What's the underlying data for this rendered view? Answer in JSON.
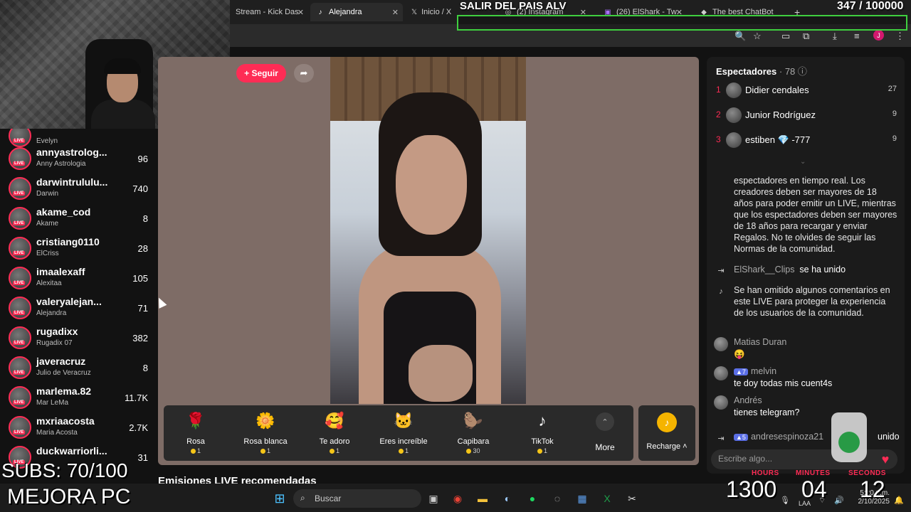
{
  "tabs": [
    {
      "label": "Stream - Kick Das",
      "icon": "kick-icon"
    },
    {
      "label": "Alejandra",
      "icon": "tiktok-icon"
    },
    {
      "label": "Inicio / X",
      "icon": "x-icon"
    },
    {
      "label": "(2) Instagram",
      "icon": "instagram-icon"
    },
    {
      "label": "(26) ElShark - Tw",
      "icon": "twitch-icon"
    },
    {
      "label": "The best ChatBot",
      "icon": "chatbot-icon"
    }
  ],
  "banner": {
    "title": "SALIR DEL PAIS ALV",
    "count": "347  / 100000"
  },
  "sidebar": {
    "items": [
      {
        "username": "",
        "display": "Evelyn",
        "count": ""
      },
      {
        "username": "annyastrolog...",
        "display": "Anny Astrologia",
        "count": "96"
      },
      {
        "username": "darwintrululu...",
        "display": "Darwin",
        "count": "740"
      },
      {
        "username": "akame_cod",
        "display": "Akame",
        "count": "8"
      },
      {
        "username": "cristiang0110",
        "display": "ElCriss",
        "count": "28"
      },
      {
        "username": "imaalexaff",
        "display": "Alexitaa",
        "count": "105"
      },
      {
        "username": "valeryalejan...",
        "display": "Alejandra",
        "count": "71"
      },
      {
        "username": "rugadixx",
        "display": "Rugadix 07",
        "count": "382"
      },
      {
        "username": "javeracruz",
        "display": "Julio de Veracruz",
        "count": "8"
      },
      {
        "username": "marlema.82",
        "display": "Mar LeMa",
        "count": "11.7K"
      },
      {
        "username": "mxriaacosta",
        "display": "Maria Acosta",
        "count": "2.7K"
      },
      {
        "username": "duckwarriorli...",
        "display": "",
        "count": "31"
      }
    ],
    "live_label": "LIVE"
  },
  "stream": {
    "follow_label": "+ Seguir",
    "share_icon": "share-icon"
  },
  "gifts": [
    {
      "name": "Rosa",
      "cost": "1",
      "icon": "rose-icon",
      "glyph": "🌹"
    },
    {
      "name": "Rosa blanca",
      "cost": "1",
      "icon": "white-rose-icon",
      "glyph": "🌼"
    },
    {
      "name": "Te adoro",
      "cost": "1",
      "icon": "heart-face-icon",
      "glyph": "🥰"
    },
    {
      "name": "Eres increíble",
      "cost": "1",
      "icon": "cat-icon",
      "glyph": "🐱"
    },
    {
      "name": "Capibara",
      "cost": "30",
      "icon": "capybara-icon",
      "glyph": "🦫"
    },
    {
      "name": "TikTok",
      "cost": "1",
      "icon": "tiktok-icon",
      "glyph": "♪"
    }
  ],
  "gift_more": "More",
  "recharge_label": "Recharge",
  "recommended_title": "Emisiones LIVE recomendadas",
  "viewers": {
    "title": "Espectadores",
    "count": "· 78",
    "list": [
      {
        "rank": "1",
        "name": "Didier cendales",
        "score": "27"
      },
      {
        "rank": "2",
        "name": "Junior Rodríguez",
        "score": "9"
      },
      {
        "rank": "3",
        "name": "estiben 💎 -777",
        "score": "9"
      }
    ]
  },
  "chat": {
    "notice": "espectadores en tiempo real. Los creadores deben ser mayores de 18 años para poder emitir un LIVE, mientras que los espectadores deben ser mayores de 18 años para recargar y enviar Regalos. No te olvides de seguir las Normas de la comunidad.",
    "joined1_name": "ElShark__Clips",
    "joined1_text": "se ha unido",
    "omitted": "Se han omitido algunos comentarios en este LIVE para proteger la experiencia de los usuarios de la comunidad.",
    "messages": [
      {
        "name": "Matias Duran",
        "text": "😝"
      },
      {
        "name": "melvin",
        "level": "7",
        "text": "te doy todas mis cuent4s"
      },
      {
        "name": "Andrés",
        "text": "tienes telegram?"
      }
    ],
    "joined2_name": "andresespinoza21",
    "joined2_level": "5",
    "joined2_text": "unido",
    "input_placeholder": "Escribe algo..."
  },
  "overlay": {
    "subs": "SUBS: 70/100",
    "mejora": "MEJORA PC",
    "timer": {
      "hours_label": "HOURS",
      "minutes_label": "MINUTES",
      "seconds_label": "SECONDS",
      "hours": "1300",
      "minutes": "04",
      "seconds": "12"
    }
  },
  "taskbar": {
    "search_label": "Buscar",
    "lang": "LAA",
    "time": "5:20 p.m.",
    "date": "2/10/2025"
  }
}
